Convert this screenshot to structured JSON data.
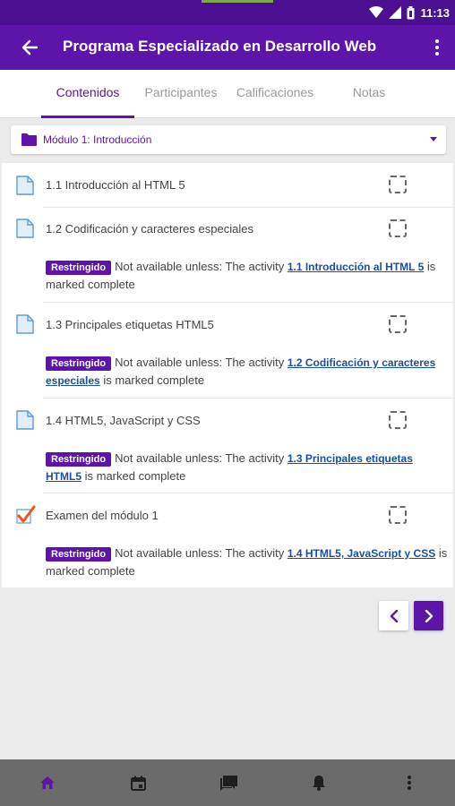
{
  "status_bar": {
    "time": "11:13"
  },
  "app_bar": {
    "title": "Programa Especializado en Desarrollo Web"
  },
  "tabs": [
    {
      "label": "Contenidos",
      "active": true
    },
    {
      "label": "Participantes",
      "active": false
    },
    {
      "label": "Calificaciones",
      "active": false
    },
    {
      "label": "Notas",
      "active": false
    }
  ],
  "section_select": {
    "value": "Módulo 1: Introducción"
  },
  "activities": [
    {
      "title": "1.1 Introducción al HTML 5",
      "icon": "page-icon"
    },
    {
      "title": "1.2 Codificación y caracteres especiales",
      "icon": "page-icon",
      "restriction": {
        "badge": "Restringido",
        "prefix": "Not available unless: The activity",
        "link": "1.1 Introducción al HTML 5",
        "suffix": "is marked complete"
      }
    },
    {
      "title": "1.3 Principales etiquetas HTML5",
      "icon": "page-icon",
      "restriction": {
        "badge": "Restringido",
        "prefix": "Not available unless: The activity",
        "link": "1.2 Codificación y caracteres especiales",
        "suffix": "is marked complete"
      }
    },
    {
      "title": "1.4 HTML5, JavaScript y CSS",
      "icon": "page-icon",
      "restriction": {
        "badge": "Restringido",
        "prefix": "Not available unless: The activity",
        "link": "1.3 Principales etiquetas HTML5",
        "suffix": "is marked complete"
      }
    },
    {
      "title": "Examen del módulo 1",
      "icon": "quiz-icon",
      "restriction": {
        "badge": "Restringido",
        "prefix": "Not available unless: The activity",
        "link": "1.4 HTML5, JavaScript y CSS",
        "suffix": "is marked complete"
      }
    }
  ],
  "pagination": {
    "prev_icon": "chevron-left-icon",
    "next_icon": "chevron-right-icon"
  },
  "bottom_nav": [
    {
      "icon": "home-icon",
      "active": true
    },
    {
      "icon": "calendar-icon",
      "active": false
    },
    {
      "icon": "messages-icon",
      "active": false
    },
    {
      "icon": "notifications-icon",
      "active": false
    },
    {
      "icon": "more-icon",
      "active": false
    }
  ],
  "colors": {
    "primary": "#5c14a9",
    "status_bar": "#4b1092",
    "link": "#1a4fa0",
    "bottom_nav": "#6b6b6b"
  }
}
